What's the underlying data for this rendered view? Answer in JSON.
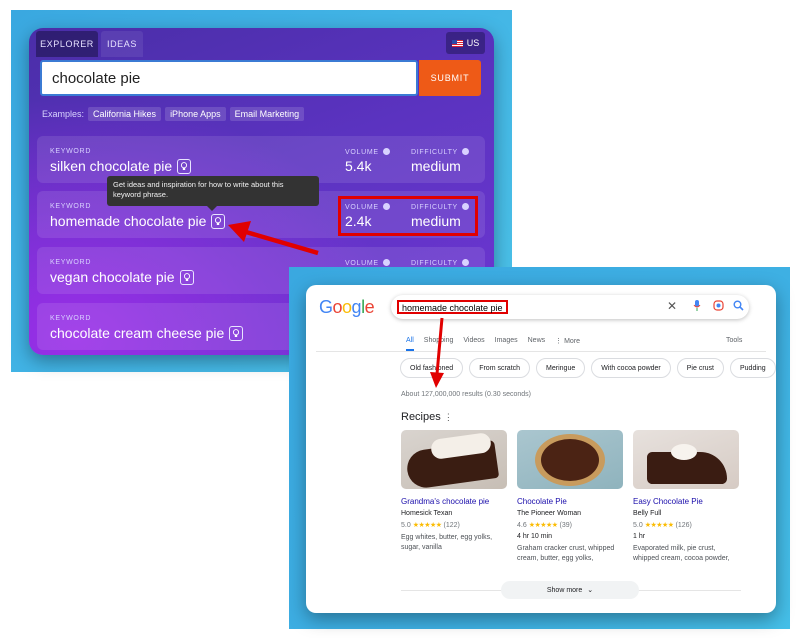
{
  "explorer": {
    "tabs": [
      {
        "label": "EXPLORER"
      },
      {
        "label": "IDEAS"
      }
    ],
    "country": "US",
    "search_value": "chocolate pie",
    "submit_label": "SUBMIT",
    "examples_label": "Examples:",
    "examples": [
      "California Hikes",
      "iPhone Apps",
      "Email Marketing"
    ],
    "keyword_label": "KEYWORD",
    "volume_label": "VOLUME",
    "difficulty_label": "DIFFICULTY",
    "rows": [
      {
        "keyword": "silken chocolate pie",
        "volume": "5.4k",
        "difficulty": "medium"
      },
      {
        "keyword": "homemade chocolate pie",
        "volume": "2.4k",
        "difficulty": "medium"
      },
      {
        "keyword": "vegan chocolate pie"
      },
      {
        "keyword": "chocolate cream cheese pie"
      }
    ],
    "tooltip": "Get ideas and inspiration for how to write about this keyword phrase."
  },
  "serp": {
    "logo": "Google",
    "query": "homemade chocolate pie",
    "tabs": [
      "All",
      "Shopping",
      "Videos",
      "Images",
      "News",
      "More"
    ],
    "tools_label": "Tools",
    "chips": [
      "Old fashioned",
      "From scratch",
      "Meringue",
      "With cocoa powder",
      "Pie crust",
      "Pudding"
    ],
    "results_count": "About 127,000,000 results (0.30 seconds)",
    "recipes_heading": "Recipes",
    "cards": [
      {
        "title": "Grandma's chocolate pie",
        "source": "Homesick Texan",
        "rating": "5.0",
        "stars": "★★★★★",
        "count": "(122)",
        "time": "",
        "desc": "Egg whites, butter, egg yolks, sugar, vanilla"
      },
      {
        "title": "Chocolate Pie",
        "source": "The Pioneer Woman",
        "rating": "4.6",
        "stars": "★★★★★",
        "count": "(39)",
        "time": "4 hr 10 min",
        "desc": "Graham cracker crust, whipped cream, butter, egg yolks,"
      },
      {
        "title": "Easy Chocolate Pie",
        "source": "Belly Full",
        "rating": "5.0",
        "stars": "★★★★★",
        "count": "(126)",
        "time": "1 hr",
        "desc": "Evaporated milk, pie crust, whipped cream, cocoa powder,"
      }
    ],
    "show_more_label": "Show more"
  },
  "colors": {
    "highlight": "#e10000",
    "submit": "#ee5a17",
    "link": "#1a0dab",
    "accent": "#1a73e8"
  }
}
